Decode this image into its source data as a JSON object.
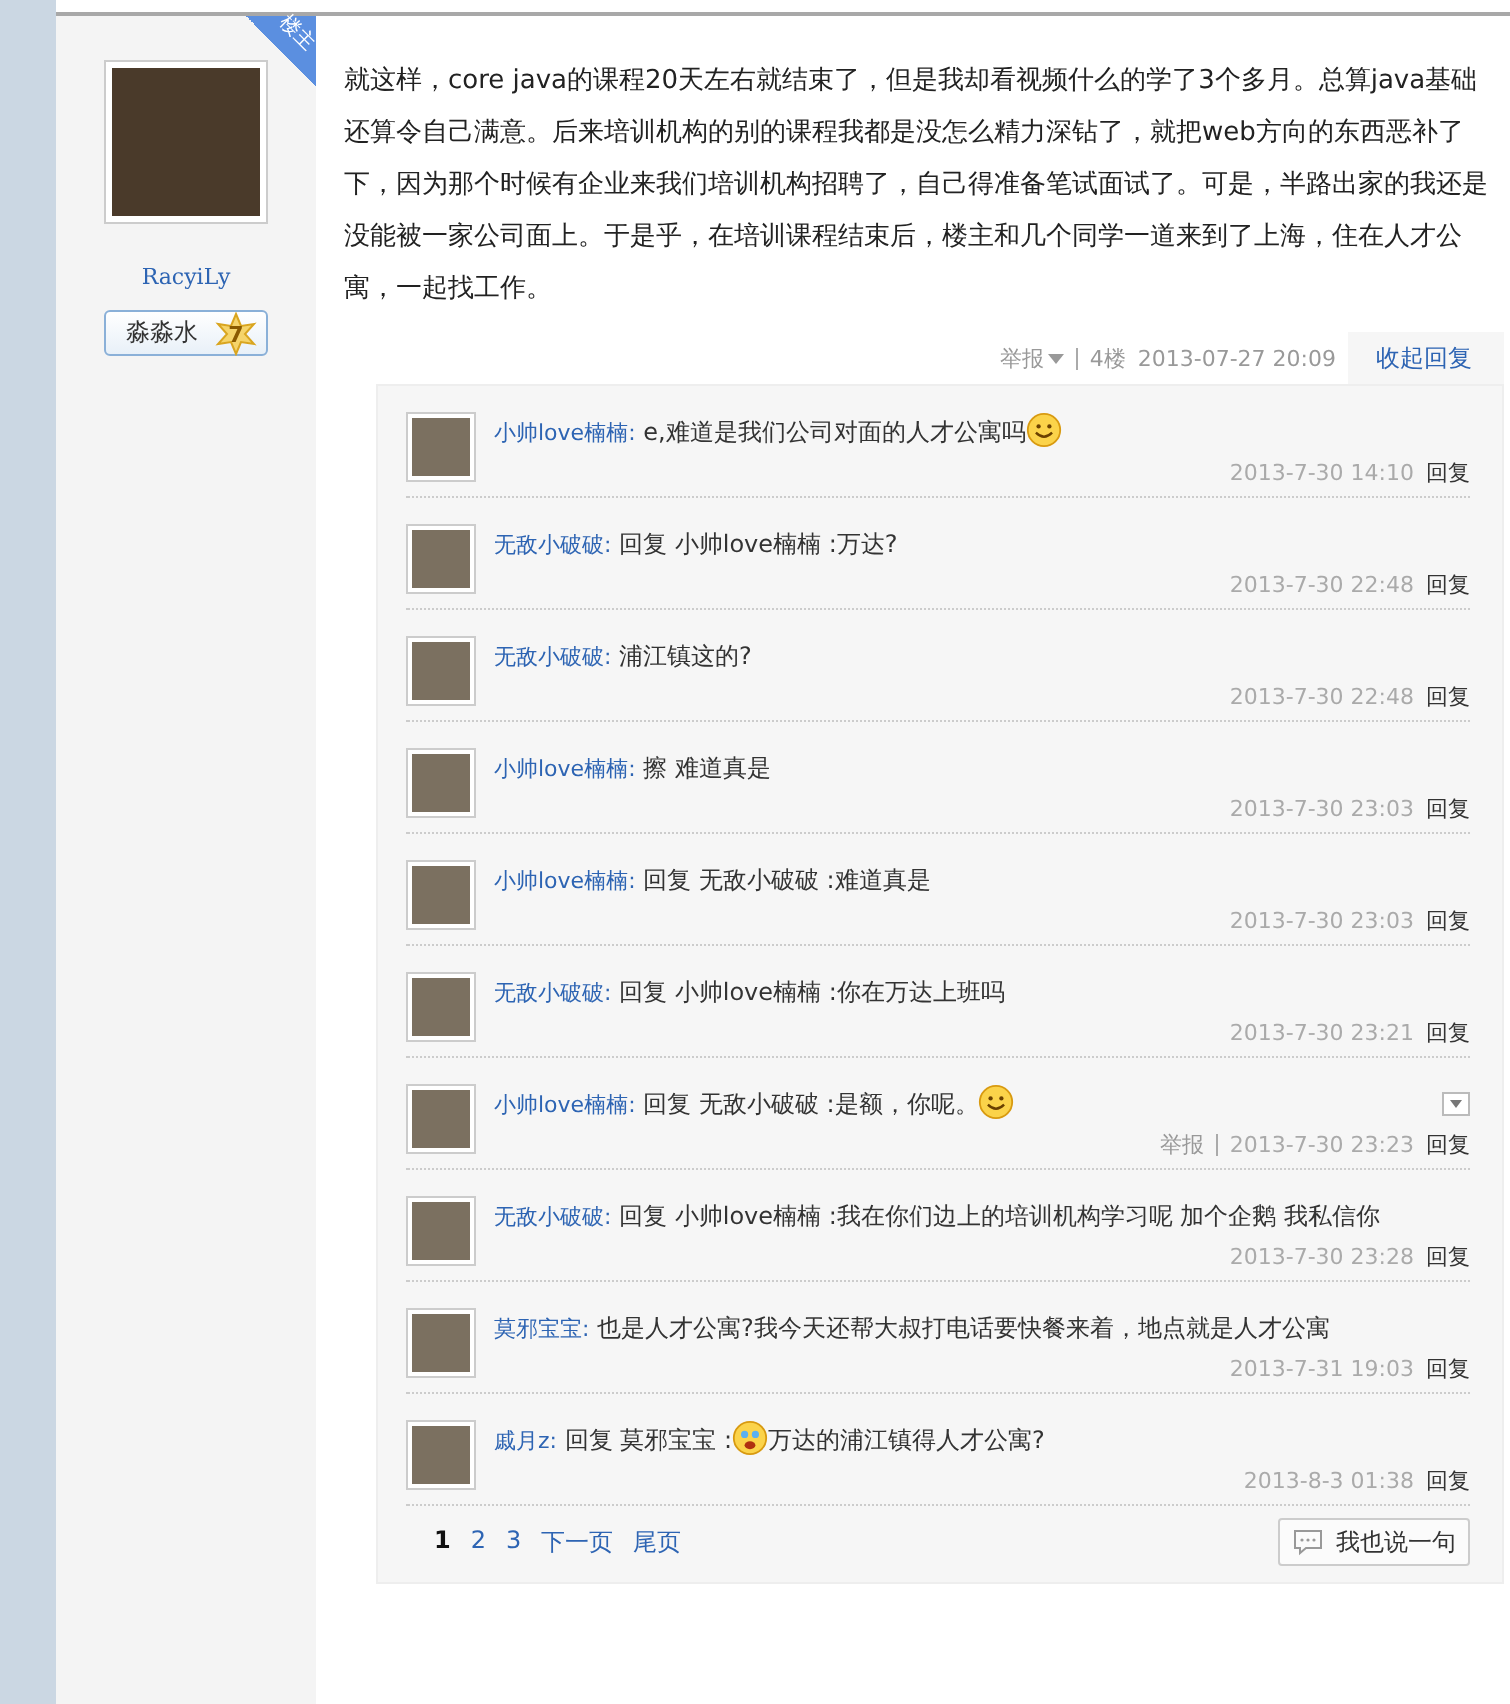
{
  "author": {
    "badge": "楼主",
    "name": "RacyiLy",
    "level_title": "淼淼水",
    "level": "7"
  },
  "post": {
    "text": "就这样，core java的课程20天左右就结束了，但是我却看视频什么的学了3个多月。总算java基础还算令自己满意。后来培训机构的别的课程我都是没怎么精力深钻了，就把web方向的东西恶补了下，因为那个时候有企业来我们培训机构招聘了，自己得准备笔试面试了。可是，半路出家的我还是没能被一家公司面上。于是乎，在培训课程结束后，楼主和几个同学一道来到了上海，住在人才公寓，一起找工作。"
  },
  "post_meta": {
    "report": "举报",
    "floor": "4楼",
    "time": "2013-07-27 20:09",
    "collapse": "收起回复"
  },
  "replies": [
    {
      "user": "小帅love楠楠:",
      "parts": [
        {
          "kind": "text",
          "text": "e,难道是我们公司对面的人才公寓吗"
        },
        {
          "kind": "smile"
        }
      ],
      "time": "2013-7-30 14:10",
      "reply": "回复"
    },
    {
      "user": "无敌小破破:",
      "parts": [
        {
          "kind": "text",
          "text": "回复 小帅love楠楠 :万达?"
        }
      ],
      "time": "2013-7-30 22:48",
      "reply": "回复"
    },
    {
      "user": "无敌小破破:",
      "parts": [
        {
          "kind": "text",
          "text": "浦江镇这的?"
        }
      ],
      "time": "2013-7-30 22:48",
      "reply": "回复"
    },
    {
      "user": "小帅love楠楠:",
      "parts": [
        {
          "kind": "text",
          "text": "擦 难道真是"
        }
      ],
      "time": "2013-7-30 23:03",
      "reply": "回复"
    },
    {
      "user": "小帅love楠楠:",
      "parts": [
        {
          "kind": "text",
          "text": "回复 无敌小破破 :难道真是"
        }
      ],
      "time": "2013-7-30 23:03",
      "reply": "回复"
    },
    {
      "user": "无敌小破破:",
      "parts": [
        {
          "kind": "text",
          "text": "回复 小帅love楠楠 :你在万达上班吗"
        }
      ],
      "time": "2013-7-30 23:21",
      "reply": "回复"
    },
    {
      "user": "小帅love楠楠:",
      "parts": [
        {
          "kind": "text",
          "text": "回复 无敌小破破 :是额，你呢。"
        },
        {
          "kind": "smile"
        }
      ],
      "report": "举报",
      "menu": true,
      "time": "2013-7-30 23:23",
      "reply": "回复"
    },
    {
      "user": "无敌小破破:",
      "parts": [
        {
          "kind": "text",
          "text": "回复 小帅love楠楠 :我在你们边上的培训机构学习呢 加个企鹅 我私信你"
        }
      ],
      "time": "2013-7-30 23:28",
      "reply": "回复"
    },
    {
      "user": "莫邪宝宝:",
      "parts": [
        {
          "kind": "text",
          "text": "也是人才公寓?我今天还帮大叔打电话要快餐来着，地点就是人才公寓"
        }
      ],
      "time": "2013-7-31 19:03",
      "reply": "回复"
    },
    {
      "user": "戚月z:",
      "parts": [
        {
          "kind": "text",
          "text": "回复 莫邪宝宝 :"
        },
        {
          "kind": "cry"
        },
        {
          "kind": "text",
          "text": "万达的浦江镇得人才公寓?"
        }
      ],
      "time": "2013-8-3 01:38",
      "reply": "回复"
    }
  ],
  "pages": [
    {
      "label": "1",
      "selected": true
    },
    {
      "label": "2",
      "selected": false
    },
    {
      "label": "3",
      "selected": false
    },
    {
      "label": "下一页",
      "selected": false
    },
    {
      "label": "尾页",
      "selected": false
    }
  ],
  "say_button": "我也说一句"
}
